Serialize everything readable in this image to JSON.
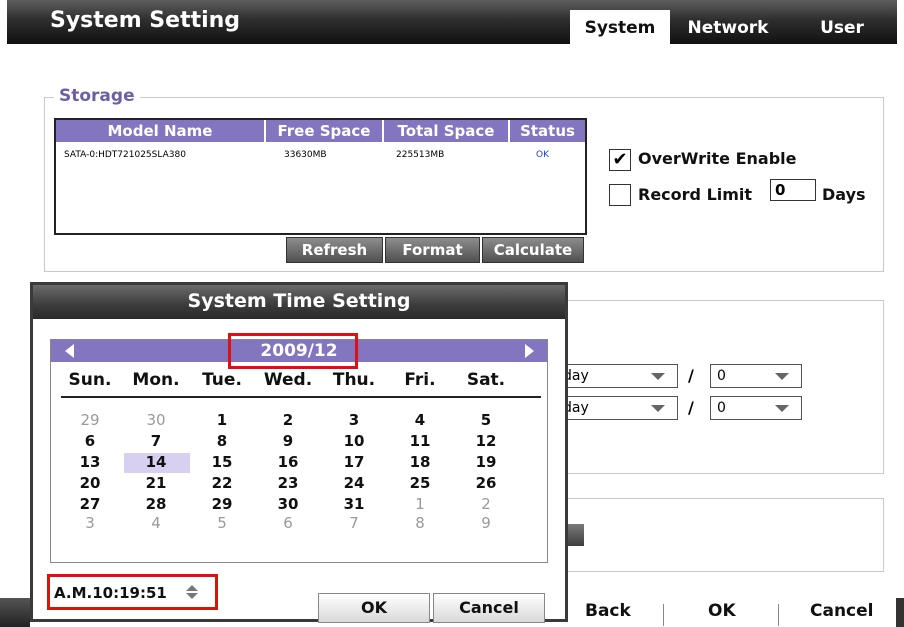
{
  "header": {
    "title": "System Setting",
    "tabs": [
      "System",
      "Network",
      "User"
    ]
  },
  "storage": {
    "legend": "Storage",
    "columns": [
      "Model Name",
      "Free Space",
      "Total Space",
      "Status"
    ],
    "rows": [
      {
        "model": "SATA-0:HDT721025SLA380",
        "free": "33630MB",
        "total": "225513MB",
        "status": "OK"
      }
    ],
    "overwrite_label": "OverWrite Enable",
    "overwrite_checked": "✔",
    "record_limit_label": "Record Limit",
    "record_limit_value": "0",
    "days_label": "Days",
    "buttons": [
      "Refresh",
      "Format",
      "Calculate"
    ]
  },
  "schedule": {
    "row1": {
      "day": "day",
      "sep": "/",
      "value": "0"
    },
    "row2": {
      "day": "day",
      "sep": "/",
      "value": "0"
    }
  },
  "bottom": {
    "back": "Back",
    "ok": "OK",
    "cancel": "Cancel"
  },
  "dialog": {
    "title": "System Time Setting",
    "month": "2009/12",
    "weekdays": [
      "Sun.",
      "Mon.",
      "Tue.",
      "Wed.",
      "Thu.",
      "Fri.",
      "Sat."
    ],
    "weeks": [
      [
        "29",
        "30",
        "1",
        "2",
        "3",
        "4",
        "5"
      ],
      [
        "6",
        "7",
        "8",
        "9",
        "10",
        "11",
        "12"
      ],
      [
        "13",
        "14",
        "15",
        "16",
        "17",
        "18",
        "19"
      ],
      [
        "20",
        "21",
        "22",
        "23",
        "24",
        "25",
        "26"
      ],
      [
        "27",
        "28",
        "29",
        "30",
        "31",
        "1",
        "2"
      ],
      [
        "3",
        "4",
        "5",
        "6",
        "7",
        "8",
        "9"
      ]
    ],
    "time": "A.M.10:19:51",
    "ok": "OK",
    "cancel": "Cancel"
  },
  "colors": {
    "accent": "#8475c0",
    "highlight": "#d8d0f0",
    "marker": "#e01010",
    "status_ok": "#1f3fd0"
  }
}
